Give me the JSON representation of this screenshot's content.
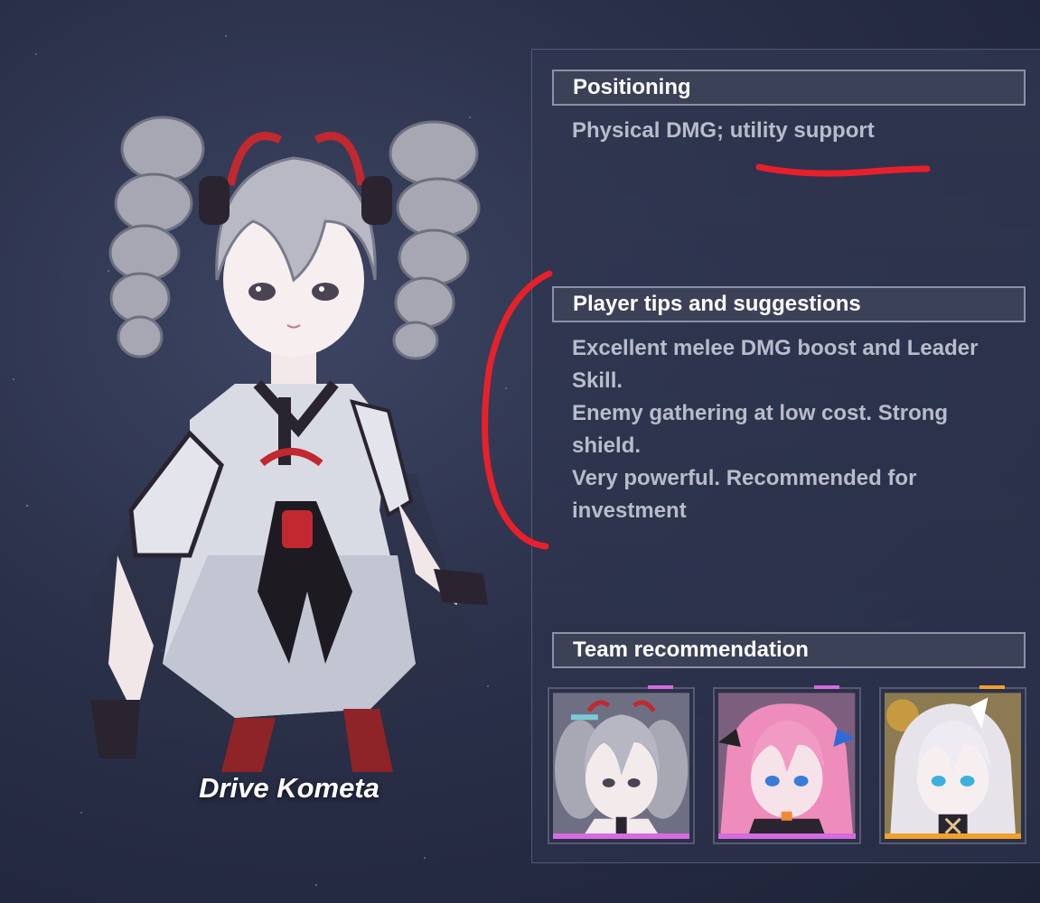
{
  "character": {
    "name": "Drive Kometa"
  },
  "positioning": {
    "header": "Positioning",
    "text": "Physical DMG; utility support"
  },
  "tips": {
    "header": "Player tips and suggestions",
    "lines": [
      "Excellent melee DMG boost and Leader Skill.",
      "Enemy gathering at low cost. Strong shield.",
      "Very powerful. Recommended for investment"
    ]
  },
  "team": {
    "header": "Team recommendation",
    "members": [
      {
        "portrait": "gray-haired-valkyrie-portrait",
        "rarity_color": "#d56be0"
      },
      {
        "portrait": "pink-haired-valkyrie-portrait",
        "rarity_color": "#d56be0"
      },
      {
        "portrait": "white-haired-valkyrie-portrait",
        "rarity_color": "#f0a12a"
      }
    ]
  },
  "annotations": {
    "color": "#e8202a"
  }
}
